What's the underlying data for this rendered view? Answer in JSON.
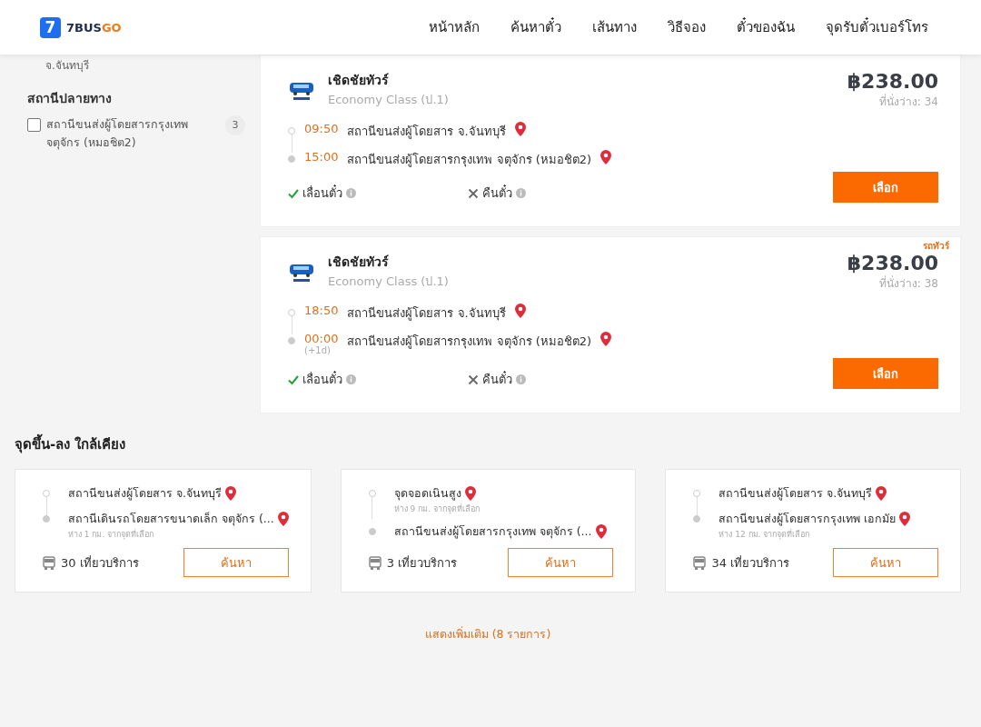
{
  "header": {
    "logo_mark": "7",
    "logo_text": "7BUS",
    "logo_accent": "GO",
    "nav": [
      "หน้าหลัก",
      "ค้นหาตั๋ว",
      "เส้นทาง",
      "วิธีจอง",
      "ตั๋วของฉัน",
      "จุดรับตั๋วเบอร์โทร"
    ]
  },
  "sidebar": {
    "cut_text": "จ.จันทบุรี",
    "filters": [
      {
        "title": "สถานีปลายทาง",
        "options": [
          {
            "label": "สถานีขนส่งผู้โดยสารกรุงเทพ จตุจักร (หมอชิต2)",
            "count": "3",
            "checked": false
          }
        ]
      }
    ]
  },
  "trips": [
    {
      "operator": "เชิดชัยทัวร์",
      "class": "Economy Class (ป.1)",
      "price": "฿238.00",
      "seats": "ที่นั่งว่าง: 34",
      "stops": [
        {
          "time": "09:50",
          "station": "สถานีขนส่งผู้โดยสาร จ.จันทบุรี"
        },
        {
          "time": "15:00",
          "station": "สถานีขนส่งผู้โดยสารกรุงเทพ จตุจักร (หมอชิต2)"
        }
      ],
      "policies": [
        {
          "label": "เลื่อนตั๋ว",
          "allowed": true
        },
        {
          "label": "คืนตั๋ว",
          "allowed": false
        }
      ],
      "button": "เลือก"
    },
    {
      "tag": "รถทัวร์",
      "operator": "เชิดชัยทัวร์",
      "class": "Economy Class (ป.1)",
      "price": "฿238.00",
      "seats": "ที่นั่งว่าง: 38",
      "stops": [
        {
          "time": "18:50",
          "station": "สถานีขนส่งผู้โดยสาร จ.จันทบุรี"
        },
        {
          "time": "00:00",
          "station": "สถานีขนส่งผู้โดยสารกรุงเทพ จตุจักร (หมอชิต2)",
          "day_offset": "(+1d)"
        }
      ],
      "policies": [
        {
          "label": "เลื่อนตั๋ว",
          "allowed": true
        },
        {
          "label": "คืนตั๋ว",
          "allowed": false
        }
      ],
      "button": "เลือก"
    }
  ],
  "nearby": {
    "title": "จุดขึ้น-ลง ใกล้เคียง",
    "cards": [
      {
        "stops": [
          {
            "name": "สถานีขนส่งผู้โดยสาร จ.จันทบุรี"
          },
          {
            "name": "สถานีเดินรถโดยสารขนาดเล็ก จตุจักร (...",
            "distance": "ห่าง 1 กม. จากจุดที่เลือก"
          }
        ],
        "trips": "30 เที่ยวบริการ",
        "button": "ค้นหา"
      },
      {
        "stops": [
          {
            "name": "จุดจอดเนินสูง",
            "distance": "ห่าง 9 กม. จากจุดที่เลือก"
          },
          {
            "name": "สถานีขนส่งผู้โดยสารกรุงเทพ จตุจักร (..."
          }
        ],
        "trips": "3 เที่ยวบริการ",
        "button": "ค้นหา"
      },
      {
        "stops": [
          {
            "name": "สถานีขนส่งผู้โดยสาร จ.จันทบุรี"
          },
          {
            "name": "สถานีขนส่งผู้โดยสารกรุงเทพ เอกมัย",
            "distance": "ห่าง 12 กม. จากจุดที่เลือก"
          }
        ],
        "trips": "34 เที่ยวบริการ",
        "button": "ค้นหา"
      }
    ]
  },
  "more_link": "แสดงเพิ่มเติม (8 รายการ)"
}
